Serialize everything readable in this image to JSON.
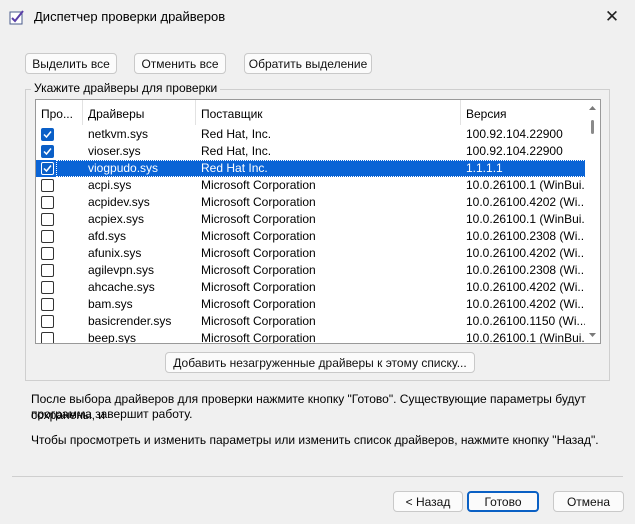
{
  "window": {
    "title": "Диспетчер проверки драйверов",
    "close_glyph": "✕"
  },
  "buttons": {
    "select_all": "Выделить все",
    "deselect_all": "Отменить все",
    "invert_selection": "Обратить выделение",
    "add_unloaded": "Добавить незагруженные драйверы к этому списку...",
    "back": "< Назад",
    "finish": "Готово",
    "cancel": "Отмена"
  },
  "group": {
    "label": "Укажите драйверы для проверки"
  },
  "table": {
    "columns": [
      "Про...",
      "Драйверы",
      "Поставщик",
      "Версия"
    ],
    "rows": [
      {
        "checked": true,
        "driver": "netkvm.sys",
        "vendor": "Red Hat, Inc.",
        "version": "100.92.104.22900"
      },
      {
        "checked": true,
        "driver": "vioser.sys",
        "vendor": "Red Hat, Inc.",
        "version": "100.92.104.22900"
      },
      {
        "checked": true,
        "driver": "viogpudo.sys",
        "vendor": "Red Hat Inc.",
        "version": "1.1.1.1",
        "selected": true
      },
      {
        "checked": false,
        "driver": "acpi.sys",
        "vendor": "Microsoft Corporation",
        "version": "10.0.26100.1 (WinBui..."
      },
      {
        "checked": false,
        "driver": "acpidev.sys",
        "vendor": "Microsoft Corporation",
        "version": "10.0.26100.4202 (Wi..."
      },
      {
        "checked": false,
        "driver": "acpiex.sys",
        "vendor": "Microsoft Corporation",
        "version": "10.0.26100.1 (WinBui..."
      },
      {
        "checked": false,
        "driver": "afd.sys",
        "vendor": "Microsoft Corporation",
        "version": "10.0.26100.2308 (Wi..."
      },
      {
        "checked": false,
        "driver": "afunix.sys",
        "vendor": "Microsoft Corporation",
        "version": "10.0.26100.4202 (Wi..."
      },
      {
        "checked": false,
        "driver": "agilevpn.sys",
        "vendor": "Microsoft Corporation",
        "version": "10.0.26100.2308 (Wi..."
      },
      {
        "checked": false,
        "driver": "ahcache.sys",
        "vendor": "Microsoft Corporation",
        "version": "10.0.26100.4202 (Wi..."
      },
      {
        "checked": false,
        "driver": "bam.sys",
        "vendor": "Microsoft Corporation",
        "version": "10.0.26100.4202 (Wi..."
      },
      {
        "checked": false,
        "driver": "basicrender.sys",
        "vendor": "Microsoft Corporation",
        "version": "10.0.26100.1150 (Wi..."
      },
      {
        "checked": false,
        "driver": "beep.sys",
        "vendor": "Microsoft Corporation",
        "version": "10.0.26100.1 (WinBui..."
      }
    ]
  },
  "info": {
    "line1": "После выбора драйверов для проверки нажмите кнопку \"Готово\". Существующие параметры будут сохранены, и",
    "line2": "программа завершит работу.",
    "line3": "Чтобы просмотреть и изменить параметры или изменить список драйверов, нажмите кнопку \"Назад\"."
  },
  "colors": {
    "selection": "#0a64d6",
    "checkbox": "#0a5fc7",
    "accent_border": "#0a60c4"
  }
}
